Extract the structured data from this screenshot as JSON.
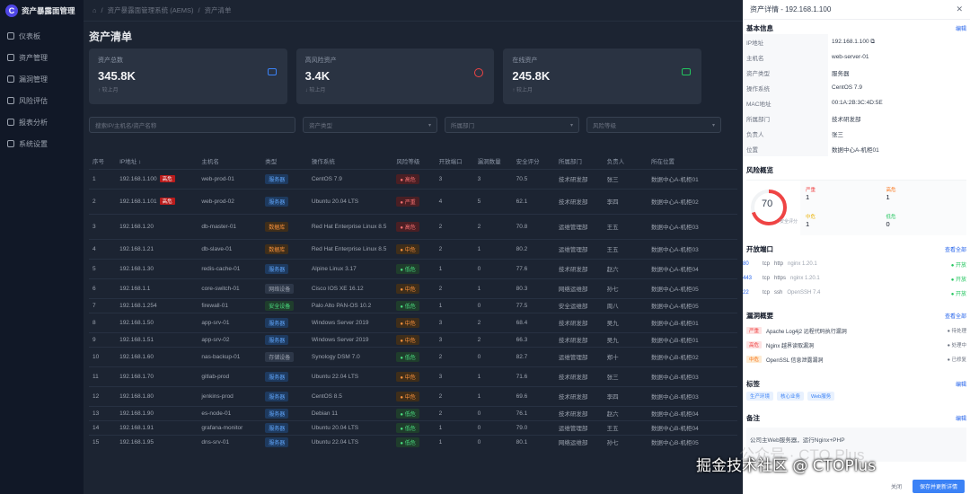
{
  "brand": {
    "logo": "C",
    "name": "资产暴露面管理"
  },
  "sidebar": {
    "items": [
      {
        "label": "仪表板",
        "icon": "dashboard-icon"
      },
      {
        "label": "资产管理",
        "icon": "folder-icon"
      },
      {
        "label": "漏洞管理",
        "icon": "bug-icon"
      },
      {
        "label": "风险评估",
        "icon": "shield-icon"
      },
      {
        "label": "报表分析",
        "icon": "chart-icon"
      },
      {
        "label": "系统设置",
        "icon": "gear-icon"
      }
    ]
  },
  "breadcrumb": {
    "home": "⌂",
    "level1": "资产暴露面管理系统 (AEMS)",
    "level2": "资产清单"
  },
  "page": {
    "title": "资产清单"
  },
  "stats": [
    {
      "label": "资产总数",
      "value": "345.8K",
      "sub": "↑ 较上月",
      "color": "#3b82f6"
    },
    {
      "label": "高风险资产",
      "value": "3.4K",
      "sub": "↓ 较上月",
      "color": "#ef4444"
    },
    {
      "label": "在线资产",
      "value": "245.8K",
      "sub": "↑ 较上月",
      "color": "#22c55e"
    }
  ],
  "filters": {
    "search": "搜索IP/主机名/资产名称",
    "type": "资产类型",
    "dept": "所属部门",
    "risk": "风险等级"
  },
  "table": {
    "headers": [
      "序号",
      "IP地址 ↕",
      "主机名",
      "类型",
      "操作系统",
      "风险等级",
      "开放端口",
      "漏洞数量",
      "安全评分",
      "所属部门",
      "负责人",
      "所在位置"
    ],
    "rows": [
      {
        "no": "1",
        "ip": "192.168.1.100",
        "tag": "高危",
        "host": "web-prod-01",
        "type": "服务器",
        "tcls": "b-blue",
        "os": "CentOS 7.9",
        "risk": "● 高危",
        "rcls": "b-red",
        "ports": "3",
        "vulns": "3",
        "score": "70.5",
        "dept": "技术研发部",
        "owner": "张三",
        "loc": "数据中心A-机柜01"
      },
      {
        "no": "2",
        "ip": "192.168.1.101",
        "tag": "高危",
        "host": "web-prod-02",
        "type": "服务器",
        "tcls": "b-blue",
        "os": "Ubuntu 20.04 LTS",
        "risk": "● 严重",
        "rcls": "b-red",
        "ports": "4",
        "vulns": "5",
        "score": "62.1",
        "dept": "技术研发部",
        "owner": "李四",
        "loc": "数据中心A-机柜02"
      },
      {
        "no": "3",
        "ip": "192.168.1.20",
        "tag": "",
        "host": "db-master-01",
        "type": "数据库",
        "tcls": "b-orange",
        "os": "Red Hat Enterprise Linux 8.5",
        "risk": "● 高危",
        "rcls": "b-red",
        "ports": "2",
        "vulns": "2",
        "score": "70.8",
        "dept": "运维管理部",
        "owner": "王五",
        "loc": "数据中心A-机柜03"
      },
      {
        "no": "4",
        "ip": "192.168.1.21",
        "tag": "",
        "host": "db-slave-01",
        "type": "数据库",
        "tcls": "b-orange",
        "os": "Red Hat Enterprise Linux 8.5",
        "risk": "● 中危",
        "rcls": "b-orange",
        "ports": "2",
        "vulns": "1",
        "score": "80.2",
        "dept": "运维管理部",
        "owner": "王五",
        "loc": "数据中心A-机柜03"
      },
      {
        "no": "5",
        "ip": "192.168.1.30",
        "tag": "",
        "host": "redis-cache-01",
        "type": "服务器",
        "tcls": "b-blue",
        "os": "Alpine Linux 3.17",
        "risk": "● 低危",
        "rcls": "b-green",
        "ports": "1",
        "vulns": "0",
        "score": "77.6",
        "dept": "技术研发部",
        "owner": "赵六",
        "loc": "数据中心A-机柜04"
      },
      {
        "no": "6",
        "ip": "192.168.1.1",
        "tag": "",
        "host": "core-switch-01",
        "type": "网络设备",
        "tcls": "b-gray",
        "os": "Cisco IOS XE 16.12",
        "risk": "● 中危",
        "rcls": "b-orange",
        "ports": "2",
        "vulns": "1",
        "score": "80.3",
        "dept": "网络运维部",
        "owner": "孙七",
        "loc": "数据中心A-机柜05"
      },
      {
        "no": "7",
        "ip": "192.168.1.254",
        "tag": "",
        "host": "firewall-01",
        "type": "安全设备",
        "tcls": "b-green",
        "os": "Palo Alto PAN-OS 10.2",
        "risk": "● 低危",
        "rcls": "b-green",
        "ports": "1",
        "vulns": "0",
        "score": "77.5",
        "dept": "安全运维部",
        "owner": "周八",
        "loc": "数据中心A-机柜05"
      },
      {
        "no": "8",
        "ip": "192.168.1.50",
        "tag": "",
        "host": "app-srv-01",
        "type": "服务器",
        "tcls": "b-blue",
        "os": "Windows Server 2019",
        "risk": "● 中危",
        "rcls": "b-orange",
        "ports": "3",
        "vulns": "2",
        "score": "68.4",
        "dept": "技术研发部",
        "owner": "吴九",
        "loc": "数据中心B-机柜01"
      },
      {
        "no": "9",
        "ip": "192.168.1.51",
        "tag": "",
        "host": "app-srv-02",
        "type": "服务器",
        "tcls": "b-blue",
        "os": "Windows Server 2019",
        "risk": "● 中危",
        "rcls": "b-orange",
        "ports": "3",
        "vulns": "2",
        "score": "66.3",
        "dept": "技术研发部",
        "owner": "吴九",
        "loc": "数据中心B-机柜01"
      },
      {
        "no": "10",
        "ip": "192.168.1.60",
        "tag": "",
        "host": "nas-backup-01",
        "type": "存储设备",
        "tcls": "b-gray",
        "os": "Synology DSM 7.0",
        "risk": "● 低危",
        "rcls": "b-green",
        "ports": "2",
        "vulns": "0",
        "score": "82.7",
        "dept": "运维管理部",
        "owner": "郑十",
        "loc": "数据中心B-机柜02"
      },
      {
        "no": "11",
        "ip": "192.168.1.70",
        "tag": "",
        "host": "gitlab-prod",
        "type": "服务器",
        "tcls": "b-blue",
        "os": "Ubuntu 22.04 LTS",
        "risk": "● 中危",
        "rcls": "b-orange",
        "ports": "3",
        "vulns": "1",
        "score": "71.6",
        "dept": "技术研发部",
        "owner": "张三",
        "loc": "数据中心B-机柜03"
      },
      {
        "no": "12",
        "ip": "192.168.1.80",
        "tag": "",
        "host": "jenkins-prod",
        "type": "服务器",
        "tcls": "b-blue",
        "os": "CentOS 8.5",
        "risk": "● 中危",
        "rcls": "b-orange",
        "ports": "2",
        "vulns": "1",
        "score": "69.6",
        "dept": "技术研发部",
        "owner": "李四",
        "loc": "数据中心B-机柜03"
      },
      {
        "no": "13",
        "ip": "192.168.1.90",
        "tag": "",
        "host": "es-node-01",
        "type": "服务器",
        "tcls": "b-blue",
        "os": "Debian 11",
        "risk": "● 低危",
        "rcls": "b-green",
        "ports": "2",
        "vulns": "0",
        "score": "76.1",
        "dept": "技术研发部",
        "owner": "赵六",
        "loc": "数据中心B-机柜04"
      },
      {
        "no": "14",
        "ip": "192.168.1.91",
        "tag": "",
        "host": "grafana-monitor",
        "type": "服务器",
        "tcls": "b-blue",
        "os": "Ubuntu 20.04 LTS",
        "risk": "● 低危",
        "rcls": "b-green",
        "ports": "1",
        "vulns": "0",
        "score": "79.0",
        "dept": "运维管理部",
        "owner": "王五",
        "loc": "数据中心B-机柜04"
      },
      {
        "no": "15",
        "ip": "192.168.1.95",
        "tag": "",
        "host": "dns-srv-01",
        "type": "服务器",
        "tcls": "b-blue",
        "os": "Ubuntu 22.04 LTS",
        "risk": "● 低危",
        "rcls": "b-green",
        "ports": "1",
        "vulns": "0",
        "score": "80.1",
        "dept": "网络运维部",
        "owner": "孙七",
        "loc": "数据中心B-机柜05"
      }
    ]
  },
  "panel": {
    "title": "资产详情 - 192.168.1.100",
    "basic": {
      "title": "基本信息",
      "link": "编辑",
      "rows": [
        {
          "k": "IP地址",
          "v": "192.168.1.100 ⧉"
        },
        {
          "k": "主机名",
          "v": "web-server-01"
        },
        {
          "k": "资产类型",
          "v": "服务器"
        },
        {
          "k": "操作系统",
          "v": "CentOS 7.9"
        },
        {
          "k": "MAC地址",
          "v": "00:1A:2B:3C:4D:5E"
        },
        {
          "k": "所属部门",
          "v": "技术研发部"
        },
        {
          "k": "负责人",
          "v": "张三"
        },
        {
          "k": "位置",
          "v": "数据中心A-机柜01"
        }
      ]
    },
    "scan": {
      "title": "风险概览",
      "score": "70",
      "score_cap": "安全评分",
      "counts": [
        {
          "k": "严重",
          "v": "1",
          "c": "#ef4444"
        },
        {
          "k": "高危",
          "v": "1",
          "c": "#f97316"
        },
        {
          "k": "中危",
          "v": "1",
          "c": "#eab308"
        },
        {
          "k": "低危",
          "v": "0",
          "c": "#22c55e"
        }
      ]
    },
    "ports": {
      "title": "开放端口",
      "link": "查看全部",
      "rows": [
        {
          "no": "80",
          "proto": "tcp",
          "svc": "http",
          "ver": "nginx 1.20.1",
          "state": "● 开放"
        },
        {
          "no": "443",
          "proto": "tcp",
          "svc": "https",
          "ver": "nginx 1.20.1",
          "state": "● 开放"
        },
        {
          "no": "22",
          "proto": "tcp",
          "svc": "ssh",
          "ver": "OpenSSH 7.4",
          "state": "● 开放"
        }
      ]
    },
    "vulns": {
      "title": "漏洞概要",
      "link": "查看全部",
      "rows": [
        {
          "lv": "严重",
          "lcls": "lv-high",
          "name": "Apache Log4j2 远程代码执行漏洞",
          "st": "● 待处理"
        },
        {
          "lv": "高危",
          "lcls": "lv-high",
          "name": "Nginx 越界读取漏洞",
          "st": "● 处理中"
        },
        {
          "lv": "中危",
          "lcls": "lv-mid",
          "name": "OpenSSL 信息泄露漏洞",
          "st": "● 已修复"
        }
      ]
    },
    "tags": {
      "title": "标签",
      "link": "编辑",
      "items": [
        "生产环境",
        "核心业务",
        "Web服务"
      ]
    },
    "remark": {
      "title": "备注",
      "link": "编辑",
      "text": "公司主Web服务器，运行Nginx+PHP"
    },
    "footer": {
      "cancel": "关闭",
      "save": "保存并更新详情"
    }
  },
  "watermark": {
    "text": "掘金技术社区 @ CTOPlus",
    "ghost": "公众号 · CTO Plus"
  }
}
